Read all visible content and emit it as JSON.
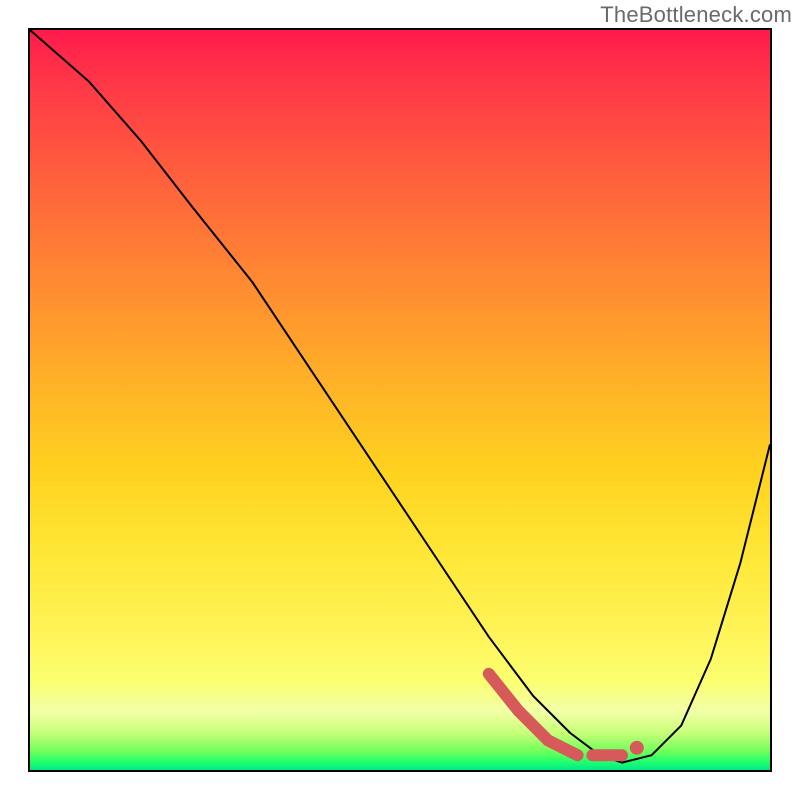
{
  "watermark": "TheBottleneck.com",
  "chart_data": {
    "type": "line",
    "title": "",
    "xlabel": "",
    "ylabel": "",
    "xlim": [
      0,
      100
    ],
    "ylim": [
      0,
      100
    ],
    "grid": false,
    "legend": false,
    "background": "red-yellow-green vertical gradient",
    "series": [
      {
        "name": "bottleneck-curve",
        "x": [
          0,
          8,
          15,
          22,
          30,
          38,
          46,
          54,
          62,
          68,
          73,
          77,
          80,
          84,
          88,
          92,
          96,
          100
        ],
        "y": [
          100,
          93,
          85,
          76,
          66,
          54,
          42,
          30,
          18,
          10,
          5,
          2,
          1,
          2,
          6,
          15,
          28,
          44
        ],
        "stroke": "#000000"
      }
    ],
    "highlight": {
      "name": "optimal-range-marker",
      "color": "#d65a5a",
      "segments": [
        {
          "x": [
            62,
            66,
            70,
            74
          ],
          "y": [
            13,
            8,
            4,
            2
          ]
        },
        {
          "x": [
            76,
            80
          ],
          "y": [
            2,
            2
          ]
        }
      ],
      "dots": [
        {
          "x": 82,
          "y": 3
        }
      ]
    }
  }
}
